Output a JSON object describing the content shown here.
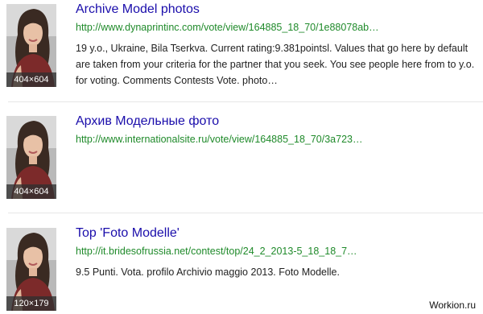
{
  "results": [
    {
      "title": "Archive Model photos",
      "url": "http://www.dynaprintinc.com/vote/view/164885_18_70/1e88078ab…",
      "snippet": "19 y.o., Ukraine, Bila Tserkva. Current rating:9.381pointsl. Values that go here by default are taken from your criteria for the partner that you seek. You see people here from to y.o. for voting. Comments Contests Vote. photo…",
      "image_size": "404×604"
    },
    {
      "title": "Архив Модельные фото",
      "url": "http://www.internationalsite.ru/vote/view/164885_18_70/3a723…",
      "snippet": "",
      "image_size": "404×604"
    },
    {
      "title": "Top 'Foto Modelle'",
      "url": "http://it.bridesofrussia.net/contest/top/24_2_2013-5_18_18_7…",
      "snippet": "9.5 Punti. Vota. profilo Archivio maggio 2013. Foto Modelle.",
      "image_size": "120×179"
    }
  ],
  "watermark": "Workion.ru",
  "colors": {
    "title": "#1a0dab",
    "url": "#1f8a2a",
    "snippet": "#222222"
  }
}
